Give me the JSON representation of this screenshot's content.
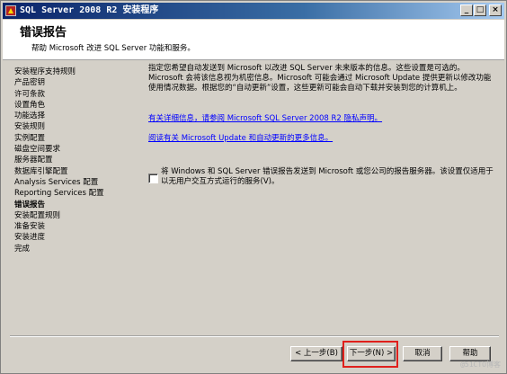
{
  "window": {
    "title": "SQL Server 2008 R2 安装程序",
    "minimize_glyph": "_",
    "maximize_glyph": "□",
    "close_glyph": "×"
  },
  "header": {
    "title": "错误报告",
    "subtitle": "帮助 Microsoft 改进 SQL Server 功能和服务。"
  },
  "nav": {
    "items": [
      "安装程序支持规则",
      "产品密钥",
      "许可条款",
      "设置角色",
      "功能选择",
      "安装规则",
      "实例配置",
      "磁盘空间要求",
      "服务器配置",
      "数据库引擎配置",
      "Analysis Services 配置",
      "Reporting Services 配置",
      "错误报告",
      "安装配置规则",
      "准备安装",
      "安装进度",
      "完成"
    ],
    "active_index": 12
  },
  "main": {
    "intro": "指定您希望自动发送到 Microsoft 以改进 SQL Server 未来版本的信息。这些设置是可选的。Microsoft 会将该信息视为机密信息。Microsoft 可能会通过 Microsoft Update 提供更新以修改功能使用情况数据。根据您的“自动更新”设置，这些更新可能会自动下载并安装到您的计算机上。",
    "link_privacy": "有关详细信息，请参阅 Microsoft SQL Server 2008 R2 隐私声明。",
    "link_update": "阅读有关 Microsoft Update 和自动更新的更多信息。",
    "checkbox_label": "将 Windows 和 SQL Server 错误报告发送到 Microsoft 或您公司的报告服务器。该设置仅适用于以无用户交互方式运行的服务(V)。",
    "checkbox_checked": false
  },
  "buttons": {
    "back": "< 上一步(B)",
    "next": "下一步(N) >",
    "cancel": "取消",
    "help": "帮助"
  },
  "watermark": "@51CTO博客",
  "colors": {
    "titlebar_start": "#0a246a",
    "titlebar_end": "#a6caf0",
    "link": "#0000ff",
    "highlight": "#e0201c",
    "window_bg": "#d4d0c8"
  }
}
